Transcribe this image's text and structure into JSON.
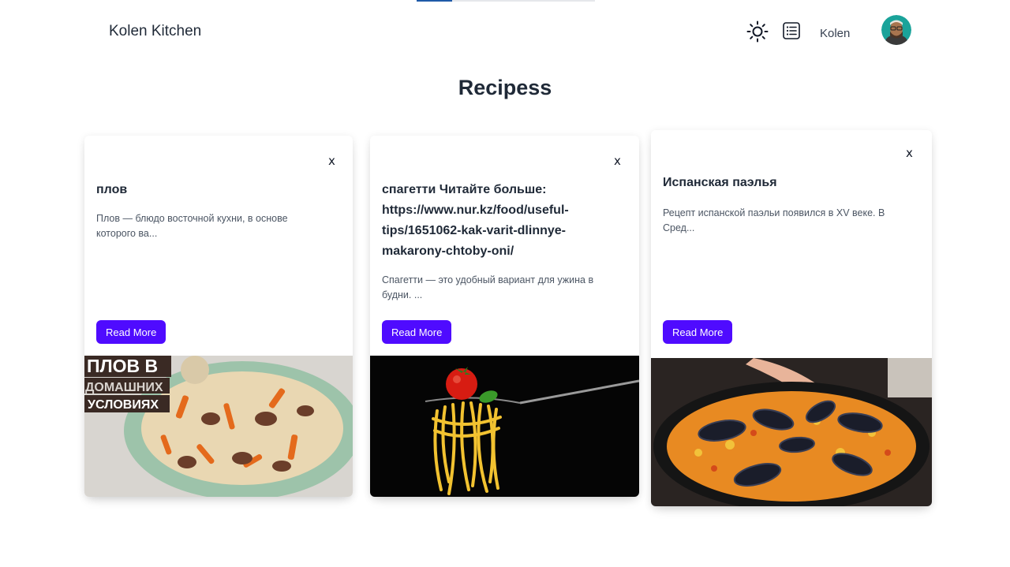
{
  "header": {
    "brand": "Kolen Kitchen",
    "theme_toggle_icon": "sun-icon",
    "list_icon": "list-icon",
    "username": "Kolen",
    "avatar_icon": "user-avatar",
    "loading_progress": 0.2
  },
  "page": {
    "title": "Recipess"
  },
  "cards": [
    {
      "close_label": "x",
      "title": "плов",
      "description": "Плов — блюдо восточной кухни, в основе которого ва...",
      "button_label": "Read More",
      "image_overlay": [
        "ПЛОВ В",
        "ДОМАШНИХ",
        "УСЛОВИЯХ"
      ]
    },
    {
      "close_label": "x",
      "title": "спагетти Читайте больше: https://www.nur.kz/food/useful-tips/1651062-kak-varit-dlinnye-makarony-chtoby-oni/",
      "description": "Спагетти — это удобный вариант для ужина в будни. ...",
      "button_label": "Read More"
    },
    {
      "close_label": "x",
      "title": "Испанская паэлья",
      "description": "Рецепт испанской паэльи появился в XV веке. В Сред...",
      "button_label": "Read More"
    }
  ],
  "colors": {
    "accent": "#4f0bff",
    "progress": "#1e5aa8",
    "text": "#1f2937"
  }
}
